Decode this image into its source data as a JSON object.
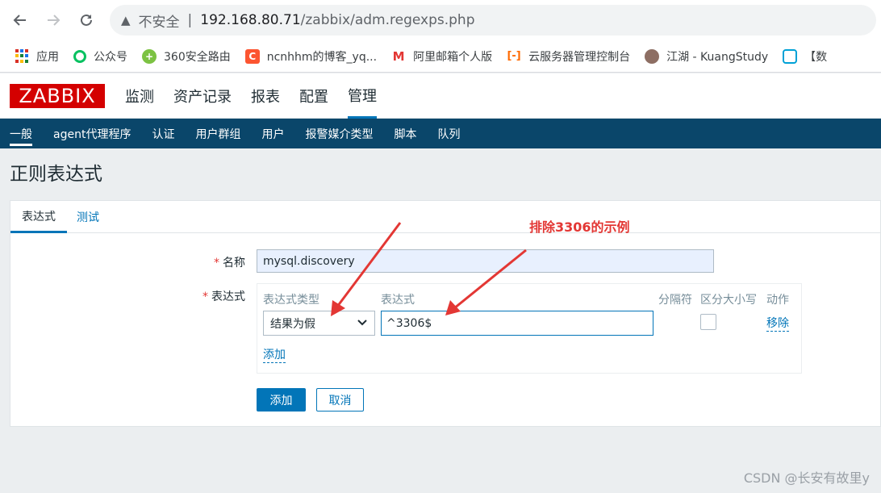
{
  "browser": {
    "insecure_label": "不安全",
    "url_host": "192.168.80.71",
    "url_path": "/zabbix/adm.regexps.php",
    "bookmarks": [
      {
        "label": "应用",
        "icon": "apps-grid-icon"
      },
      {
        "label": "公众号",
        "icon": "wechat-icon"
      },
      {
        "label": "360安全路由",
        "icon": "360-icon"
      },
      {
        "label": "ncnhhm的博客_yq...",
        "icon": "csdn-icon"
      },
      {
        "label": "阿里邮箱个人版",
        "icon": "aliyun-mail-icon"
      },
      {
        "label": "云服务器管理控制台",
        "icon": "aliyun-icon"
      },
      {
        "label": "江湖 - KuangStudy",
        "icon": "avatar-icon"
      },
      {
        "label": "【数",
        "icon": "bilibili-icon"
      }
    ]
  },
  "header": {
    "logo": "ZABBIX",
    "menu": [
      "监测",
      "资产记录",
      "报表",
      "配置",
      "管理"
    ]
  },
  "submenu": [
    "一般",
    "agent代理程序",
    "认证",
    "用户群组",
    "用户",
    "报警媒介类型",
    "脚本",
    "队列"
  ],
  "page": {
    "title": "正则表达式"
  },
  "tabs": [
    "表达式",
    "测试"
  ],
  "form": {
    "name_label": "名称",
    "name_value": "mysql.discovery",
    "expr_label": "表达式",
    "columns": [
      "表达式类型",
      "表达式",
      "分隔符",
      "区分大小写",
      "动作"
    ],
    "type_value": "结果为假",
    "expr_value": "^3306$",
    "remove_label": "移除",
    "add_link_label": "添加",
    "submit_label": "添加",
    "cancel_label": "取消"
  },
  "annotation": "排除3306的示例",
  "watermark": "CSDN @长安有故里y",
  "colors": {
    "accent": "#0275b8",
    "logo": "#d40000",
    "submenu_bg": "#0a466a",
    "annotation": "#e33734"
  }
}
